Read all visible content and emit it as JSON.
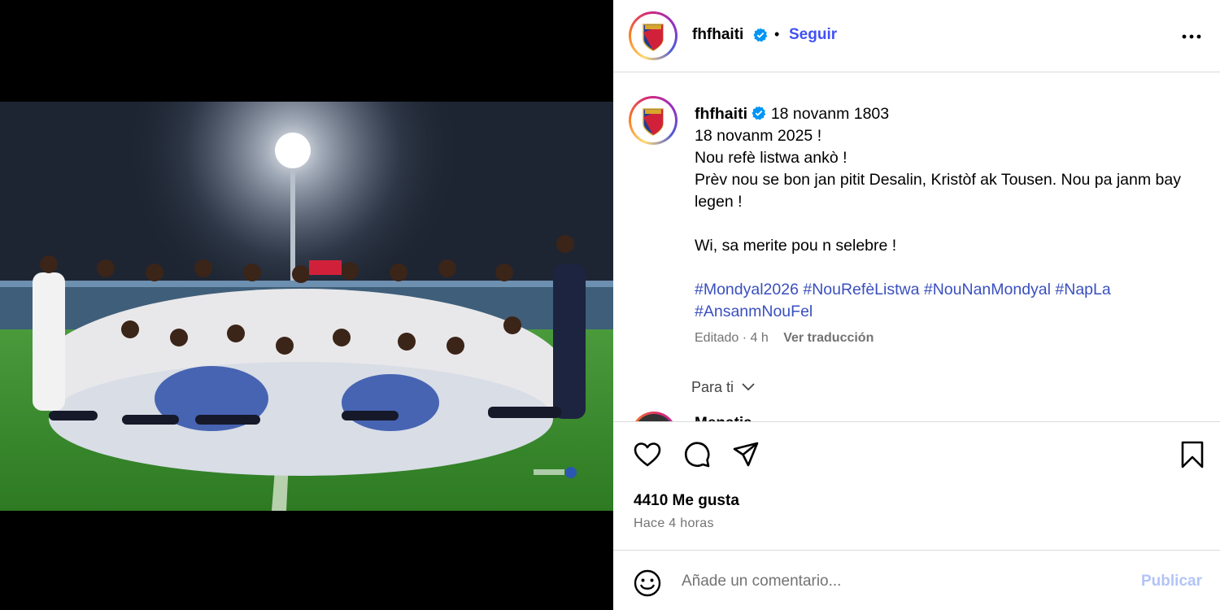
{
  "colors": {
    "accent": "#4150f7",
    "hashtag": "#3a4fbf",
    "muted": "#737373",
    "publish_disabled": "#b3c4f7"
  },
  "header": {
    "username": "fhfhaiti",
    "verified_icon": "verified-badge-icon",
    "separator": "•",
    "follow_label": "Seguir",
    "more_icon": "more-options-icon"
  },
  "caption": {
    "username": "fhfhaiti",
    "lines": [
      "18 novanm 1803",
      "18 novanm 2025 !",
      "Nou refè listwa ankò !",
      "Prèv nou se bon jan pitit Desalin, Kristòf ak Tousen. Nou pa janm bay legen !",
      "Wi, sa merite pou n selebre !"
    ],
    "hashtags": [
      "#Mondyal2026",
      "#NouRefèListwa",
      "#NouNanMondyal",
      "#NapLa",
      "#AnsanmNouFel"
    ],
    "edited": "Editado",
    "age": "4 h",
    "translate_label": "Ver traducción"
  },
  "for_you": {
    "label": "Para ti"
  },
  "next_comment": {
    "text": "Menatia"
  },
  "actions": {
    "like_icon": "heart-icon",
    "comment_icon": "comment-icon",
    "share_icon": "share-icon",
    "save_icon": "bookmark-icon"
  },
  "stats": {
    "likes": "4410 Me gusta",
    "time_ago": "Hace 4 horas"
  },
  "comment_box": {
    "placeholder": "Añade un comentario...",
    "publish_label": "Publicar"
  }
}
